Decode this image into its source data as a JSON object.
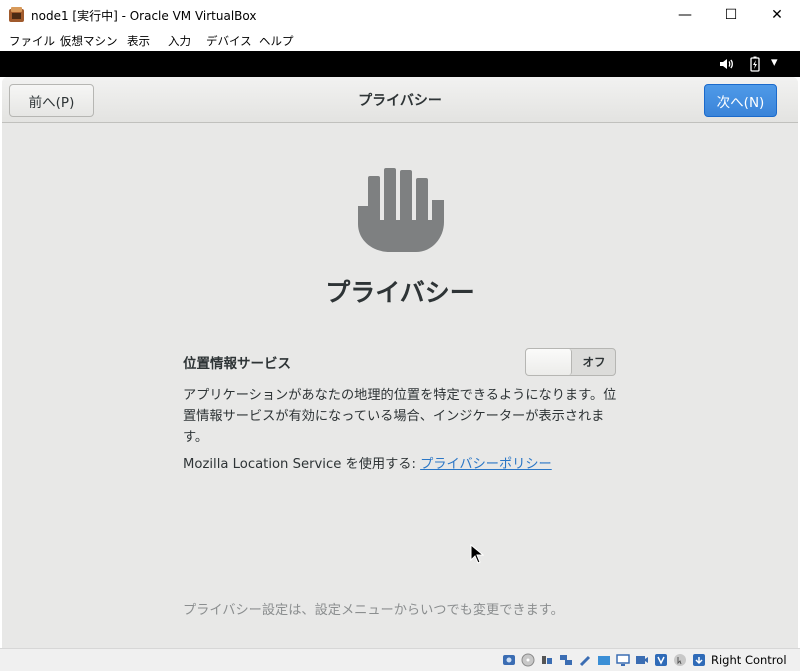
{
  "window": {
    "title": "node1 [実行中] - Oracle VM VirtualBox",
    "minimize": "—",
    "maximize": "☐",
    "close": "✕"
  },
  "menu": [
    "ファイル",
    "仮想マシン",
    "表示",
    "入力",
    "デバイス",
    "ヘルプ"
  ],
  "tray": {
    "icons": [
      "volume-icon",
      "battery-icon",
      "system-menu-arrow-icon"
    ],
    "arrow": "▾"
  },
  "header": {
    "prev_label": "前へ(P)",
    "title": "プライバシー",
    "next_label": "次へ(N)"
  },
  "page": {
    "icon": "hand-icon",
    "heading": "プライバシー",
    "location_label": "位置情報サービス",
    "toggle_state": "オフ",
    "description": "アプリケーションがあなたの地理的位置を特定できるようになります。位置情報サービスが有効になっている場合、インジケーターが表示されます。",
    "service_text": "Mozilla Location Service を使用する: ",
    "policy_link": "プライバシーポリシー",
    "footer_note": "プライバシー設定は、設定メニューからいつでも変更できます。"
  },
  "statusbar": {
    "icons": [
      "hard-disk-icon",
      "optical-disk-icon",
      "audio-icon",
      "network-icon",
      "usb-icon",
      "shared-folders-icon",
      "display-icon",
      "video-capture-icon",
      "virtualization-icon",
      "mouse-integration-icon",
      "host-key-arrow-icon"
    ],
    "host_key": "Right Control"
  },
  "colors": {
    "accent": "#3a84d9",
    "link": "#2a76c6",
    "guest_background": "#e8e8e7",
    "icon_gray": "#7e8081"
  }
}
